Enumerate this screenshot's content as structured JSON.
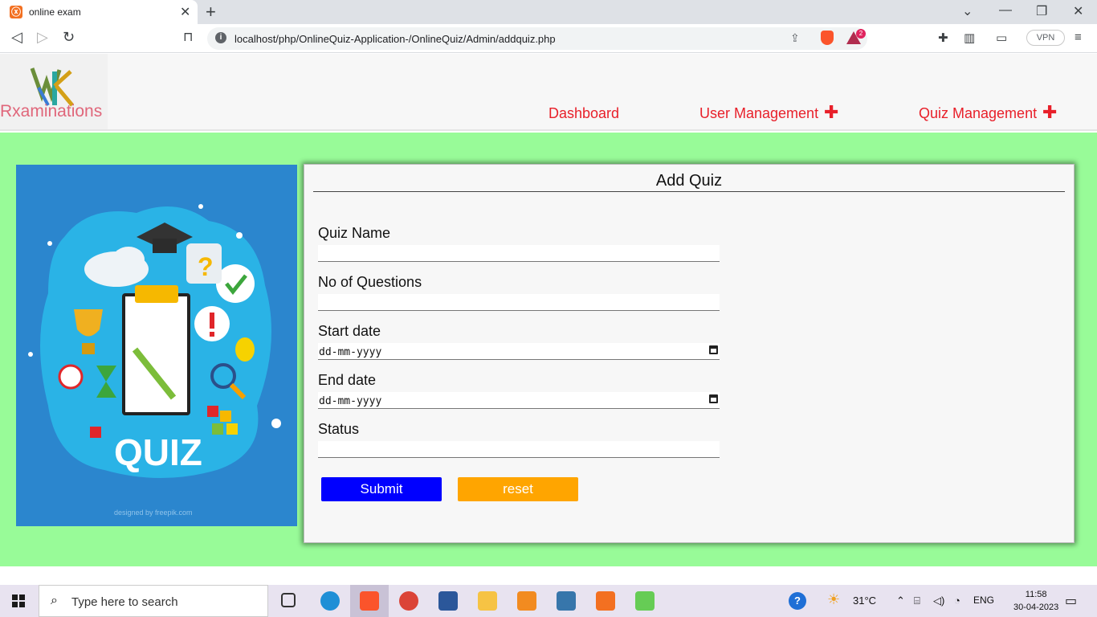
{
  "browser": {
    "tab_title": "online exam",
    "url": "localhost/php/OnlineQuiz-Application-/OnlineQuiz/Admin/addquiz.php",
    "vpn_label": "VPN",
    "rewards_badge": "2"
  },
  "site": {
    "logo_text": "Rxaminations",
    "nav": {
      "dashboard": "Dashboard",
      "user_management": "User Management",
      "quiz_management": "Quiz Management",
      "plus": "✚"
    },
    "image_caption": "QUIZ",
    "image_credit": "designed by freepik.com"
  },
  "form": {
    "title": "Add Quiz",
    "quiz_name_label": "Quiz Name",
    "quiz_name_value": "",
    "questions_label": "No of Questions",
    "questions_value": "",
    "start_label": "Start date",
    "start_value": "dd-mm-yyyy",
    "end_label": "End date",
    "end_value": "dd-mm-yyyy",
    "status_label": "Status",
    "status_value": "",
    "submit_label": "Submit",
    "reset_label": "reset"
  },
  "taskbar": {
    "search_placeholder": "Type here to search",
    "weather": "31°C",
    "language": "ENG",
    "time": "11:58",
    "date": "30-04-2023"
  },
  "colors": {
    "page_bg": "#98fb98",
    "nav_text": "#e8202a",
    "submit_bg": "#0000ff",
    "reset_bg": "#ffa500",
    "logo_text": "#e0667a"
  }
}
